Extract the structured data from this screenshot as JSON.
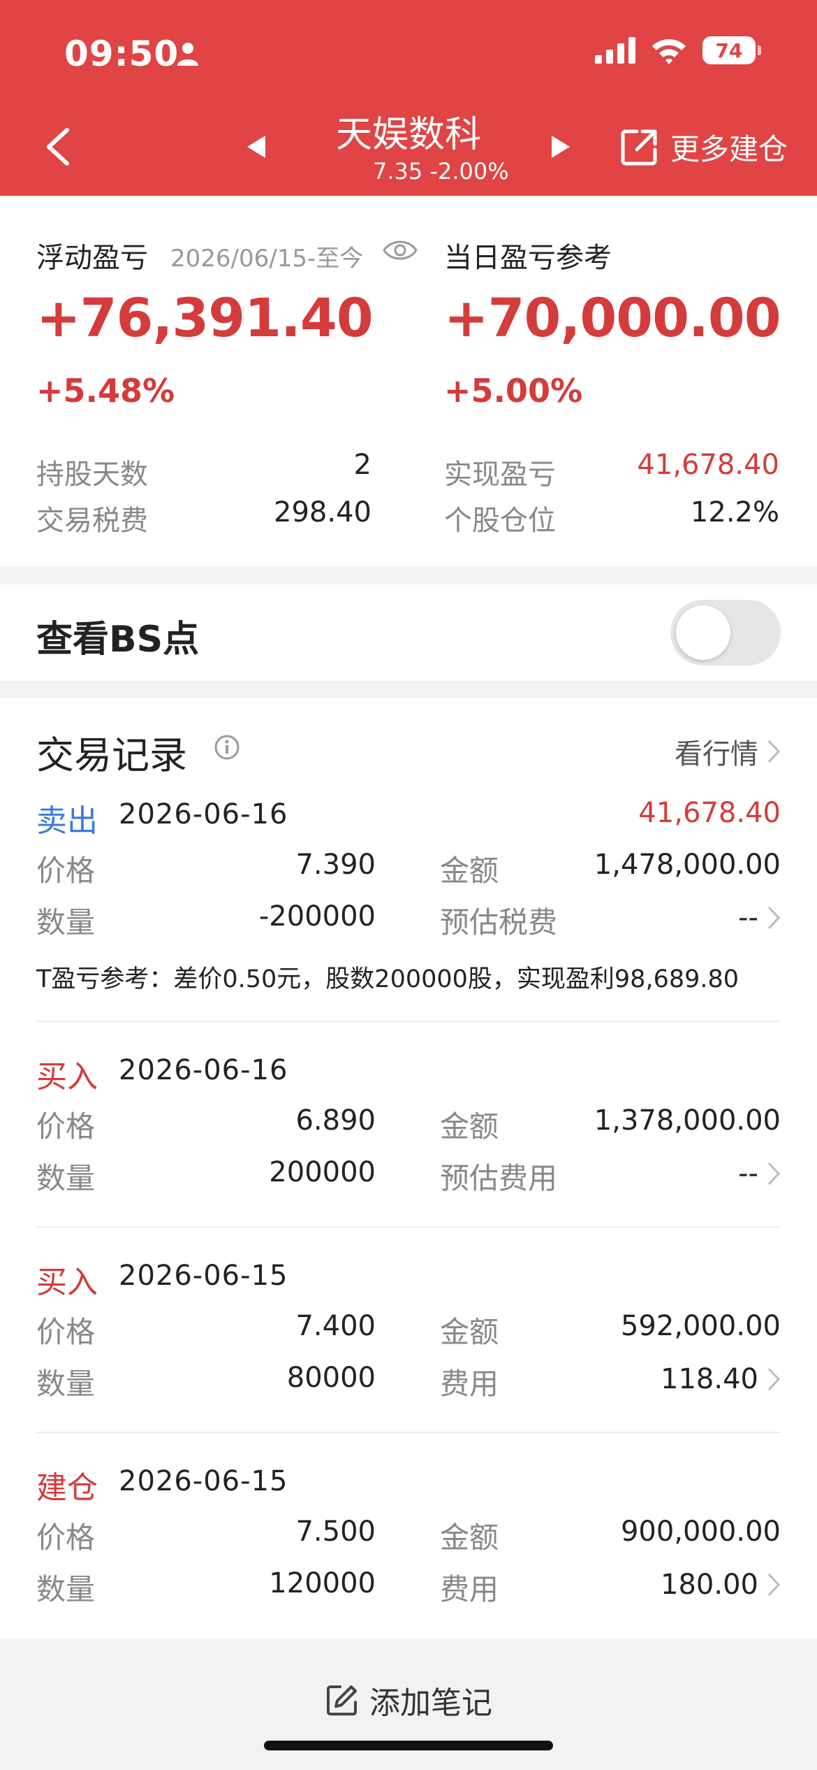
{
  "status_bar": {
    "time": "09:50",
    "battery": "74"
  },
  "nav": {
    "title": "天娱数科",
    "price": "7.35",
    "change": "-2.00%",
    "more_label": "更多建仓"
  },
  "summary": {
    "float_pl_label": "浮动盈亏",
    "float_pl_range": "2026/06/15-至今",
    "float_pl_value": "+76,391.40",
    "float_pl_pct": "+5.48%",
    "daily_pl_label": "当日盈亏参考",
    "daily_pl_value": "+70,000.00",
    "daily_pl_pct": "+5.00%",
    "hold_days_label": "持股天数",
    "hold_days_value": "2",
    "realized_label": "实现盈亏",
    "realized_value": "41,678.40",
    "tax_label": "交易税费",
    "tax_value": "298.40",
    "position_label": "个股仓位",
    "position_value": "12.2%"
  },
  "bs_toggle": {
    "label": "查看BS点",
    "on": false
  },
  "records": {
    "title": "交易记录",
    "market_link": "看行情",
    "items": [
      {
        "type": "卖出",
        "date": "2026-06-16",
        "profit": "41,678.40",
        "price_label": "价格",
        "price": "7.390",
        "amount_label": "金额",
        "amount": "1,478,000.00",
        "qty_label": "数量",
        "qty": "-200000",
        "fee_label": "预估税费",
        "fee": "--",
        "note": "T盈亏参考：差价0.50元，股数200000股，实现盈利98,689.80"
      },
      {
        "type": "买入",
        "date": "2026-06-16",
        "price_label": "价格",
        "price": "6.890",
        "amount_label": "金额",
        "amount": "1,378,000.00",
        "qty_label": "数量",
        "qty": "200000",
        "fee_label": "预估费用",
        "fee": "--"
      },
      {
        "type": "买入",
        "date": "2026-06-15",
        "price_label": "价格",
        "price": "7.400",
        "amount_label": "金额",
        "amount": "592,000.00",
        "qty_label": "数量",
        "qty": "80000",
        "fee_label": "费用",
        "fee": "118.40"
      },
      {
        "type": "建仓",
        "date": "2026-06-15",
        "price_label": "价格",
        "price": "7.500",
        "amount_label": "金额",
        "amount": "900,000.00",
        "qty_label": "数量",
        "qty": "120000",
        "fee_label": "费用",
        "fee": "180.00"
      }
    ]
  },
  "footer": {
    "add_note": "添加笔记"
  },
  "colors": {
    "header": "#e04444",
    "profit_red": "#d43b3b",
    "sell_blue": "#3c7ad8"
  }
}
